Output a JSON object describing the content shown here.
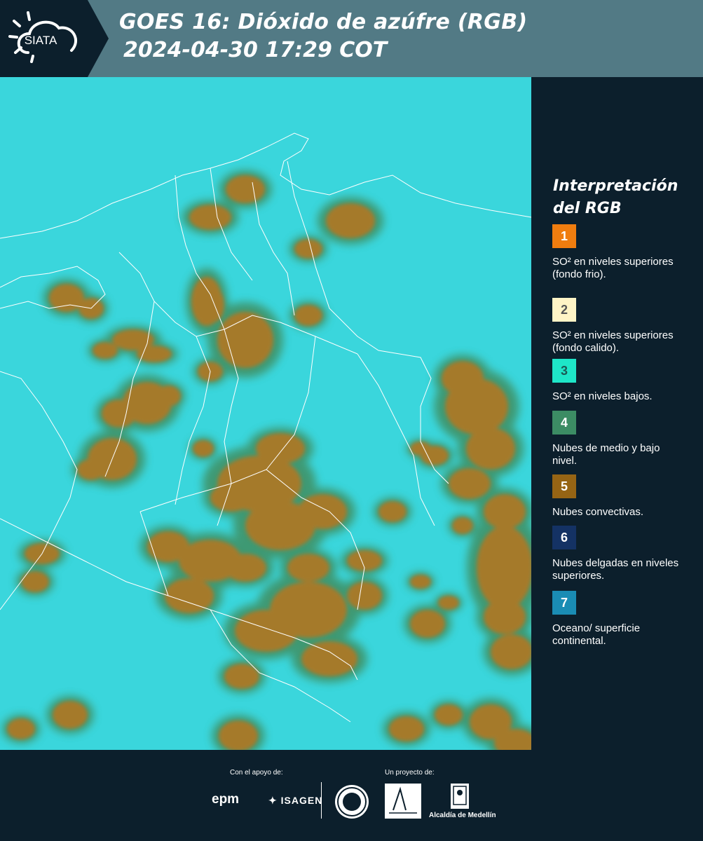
{
  "header": {
    "logo_text": "SIATA",
    "title_line1": "GOES 16: Dióxido de azúfre (RGB)",
    "title_line2": "2024-04-30 17:29 COT"
  },
  "legend": {
    "title": "Interpretación del RGB",
    "items": [
      {
        "number": "1",
        "label": "SO² en niveles superiores (fondo frio).",
        "color": "#f07d0f",
        "text_color": "#ffffff"
      },
      {
        "number": "2",
        "label": "SO² en niveles superiores (fondo calido).",
        "color": "#fff4c6",
        "text_color": "#555555"
      },
      {
        "number": "3",
        "label": "SO² en niveles bajos.",
        "color": "#1ee6c8",
        "text_color": "#1b5a55"
      },
      {
        "number": "4",
        "label": "Nubes de medio y bajo nivel.",
        "color": "#3c8c64",
        "text_color": "#ffffff"
      },
      {
        "number": "5",
        "label": "Nubes convectivas.",
        "color": "#966414",
        "text_color": "#ffffff"
      },
      {
        "number": "6",
        "label": "Nubes delgadas en niveles superiores.",
        "color": "#143264",
        "text_color": "#ffffff"
      },
      {
        "number": "7",
        "label": "Oceano/ superficie continental.",
        "color": "#1a8cb4",
        "text_color": "#ffffff"
      }
    ]
  },
  "map": {
    "background_color": "#3ad6dc",
    "cloud_color": "#a57a2a",
    "cloud_edge_color": "#3f8a5a",
    "border_color": "#ffffff"
  },
  "footer": {
    "support_label": "Con el apoyo de:",
    "project_label": "Un proyecto de:",
    "sponsor1": "epm",
    "sponsor2": "ISAGEN",
    "partner1": "Alcaldía de Medellín seal",
    "partner2": "Área Metropolitana Valle de Aburrá",
    "partner3": "Alcaldía de Medellín"
  }
}
